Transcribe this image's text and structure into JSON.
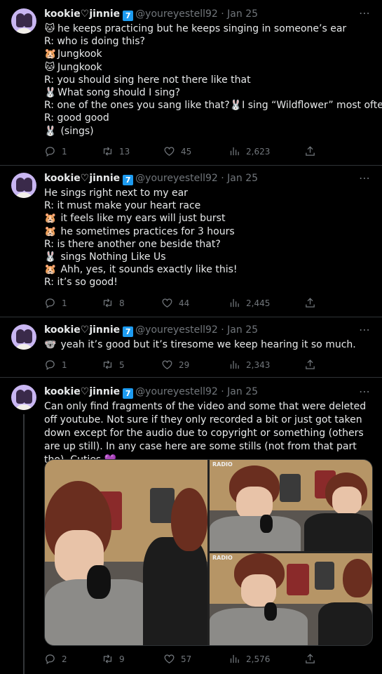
{
  "tweets": [
    {
      "name": "kookie♡jinnie",
      "badge": "7",
      "handle": "@youreyestell92 · Jan 25",
      "lines": [
        {
          "emoji": "🐱",
          "text": "he keeps practicing but he keeps singing in someone’s ear"
        },
        {
          "emoji": "",
          "text": "R: who is doing this?"
        },
        {
          "emoji": "🐹",
          "text": "Jungkook"
        },
        {
          "emoji": "🐱",
          "text": "Jungkook"
        },
        {
          "emoji": "",
          "text": "R: you should sing here not there like that"
        },
        {
          "emoji": "🐰",
          "text": "What song should I sing?"
        },
        {
          "emoji": "",
          "text": "R: one of the ones you sang like that?🐰I sing “Wildflower” most often"
        },
        {
          "emoji": "",
          "text": "R: good good"
        },
        {
          "emoji": "🐰",
          "text": " (sings)"
        }
      ],
      "stats": {
        "replies": "1",
        "retweets": "13",
        "likes": "45",
        "views": "2,623"
      }
    },
    {
      "name": "kookie♡jinnie",
      "badge": "7",
      "handle": "@youreyestell92 · Jan 25",
      "lines": [
        {
          "emoji": "",
          "text": "He sings right next to my ear"
        },
        {
          "emoji": "",
          "text": "R: it must make your heart race"
        },
        {
          "emoji": "🐹",
          "text": " it feels like my ears will just burst"
        },
        {
          "emoji": "🐹",
          "text": " he sometimes practices for 3 hours"
        },
        {
          "emoji": "",
          "text": "R: is there another one beside that?"
        },
        {
          "emoji": "🐰",
          "text": " sings Nothing Like Us"
        },
        {
          "emoji": "🐹",
          "text": " Ahh, yes, it sounds exactly like this!"
        },
        {
          "emoji": "",
          "text": "R: it’s so good!"
        }
      ],
      "stats": {
        "replies": "1",
        "retweets": "8",
        "likes": "44",
        "views": "2,445"
      }
    },
    {
      "name": "kookie♡jinnie",
      "badge": "7",
      "handle": "@youreyestell92 · Jan 25",
      "lines": [
        {
          "emoji": "🐨",
          "text": " yeah it’s good but it’s tiresome we keep hearing it so much."
        }
      ],
      "stats": {
        "replies": "1",
        "retweets": "5",
        "likes": "29",
        "views": "2,343"
      }
    },
    {
      "name": "kookie♡jinnie",
      "badge": "7",
      "handle": "@youreyestell92 · Jan 25",
      "paragraph": "Can only find fragments of the video and some that were deleted off youtube. Not sure if they only recorded a bit or just got taken down except for the audio due to copyright or something (others are up still). In any case here are some stills (not from that part tho). Cuties 💜",
      "media_label": "RADIO",
      "stats": {
        "replies": "2",
        "retweets": "9",
        "likes": "57",
        "views": "2,576"
      }
    }
  ],
  "more_icon": "⋯"
}
